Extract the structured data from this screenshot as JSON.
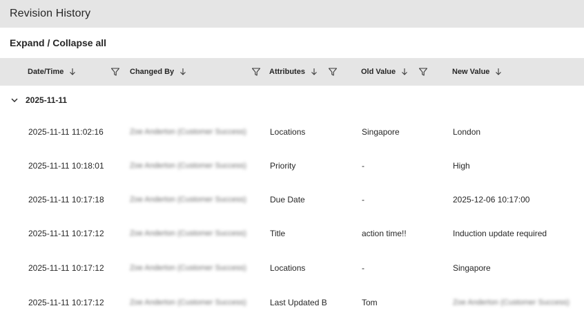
{
  "header": {
    "title": "Revision History"
  },
  "toolbar": {
    "expand_collapse_label": "Expand / Collapse all"
  },
  "columns": [
    {
      "key": "datetime",
      "label": "Date/Time",
      "filter_icon": "filter-icon",
      "sort_icon": "arrow-down-icon"
    },
    {
      "key": "changed_by",
      "label": "Changed By",
      "filter_icon": "filter-icon",
      "sort_icon": "arrow-down-icon"
    },
    {
      "key": "attributes",
      "label": "Attributes",
      "filter_icon": "filter-icon",
      "sort_icon": "arrow-down-icon"
    },
    {
      "key": "old_value",
      "label": "Old Value",
      "filter_icon": "filter-icon",
      "sort_icon": "arrow-down-icon"
    },
    {
      "key": "new_value",
      "label": "New Value",
      "sort_icon": "arrow-down-icon"
    }
  ],
  "group": {
    "label": "2025-11-11",
    "expanded_icon": "chevron-down-icon"
  },
  "rows": [
    {
      "datetime": "2025-11-11 11:02:16",
      "changed_by": "Zoe Anderton (Customer Success)",
      "attribute": "Locations",
      "old_value": "Singapore",
      "new_value": "London"
    },
    {
      "datetime": "2025-11-11 10:18:01",
      "changed_by": "Zoe Anderton (Customer Success)",
      "attribute": "Priority",
      "old_value": "-",
      "new_value": "High"
    },
    {
      "datetime": "2025-11-11 10:17:18",
      "changed_by": "Zoe Anderton (Customer Success)",
      "attribute": "Due Date",
      "old_value": "-",
      "new_value": "2025-12-06 10:17:00"
    },
    {
      "datetime": "2025-11-11 10:17:12",
      "changed_by": "Zoe Anderton (Customer Success)",
      "attribute": "Title",
      "old_value": "action time!!",
      "new_value": "Induction update required"
    },
    {
      "datetime": "2025-11-11 10:17:12",
      "changed_by": "Zoe Anderton (Customer Success)",
      "attribute": "Locations",
      "old_value": "-",
      "new_value": "Singapore"
    },
    {
      "datetime": "2025-11-11 10:17:12",
      "changed_by": "Zoe Anderton (Customer Success)",
      "attribute": "Last Updated By",
      "old_value": "Tom",
      "new_value": "Zoe Anderton (Customer Success)"
    }
  ],
  "colors": {
    "header_bg": "#e5e5e5",
    "text": "#262626",
    "muted": "#6f6f6f"
  }
}
